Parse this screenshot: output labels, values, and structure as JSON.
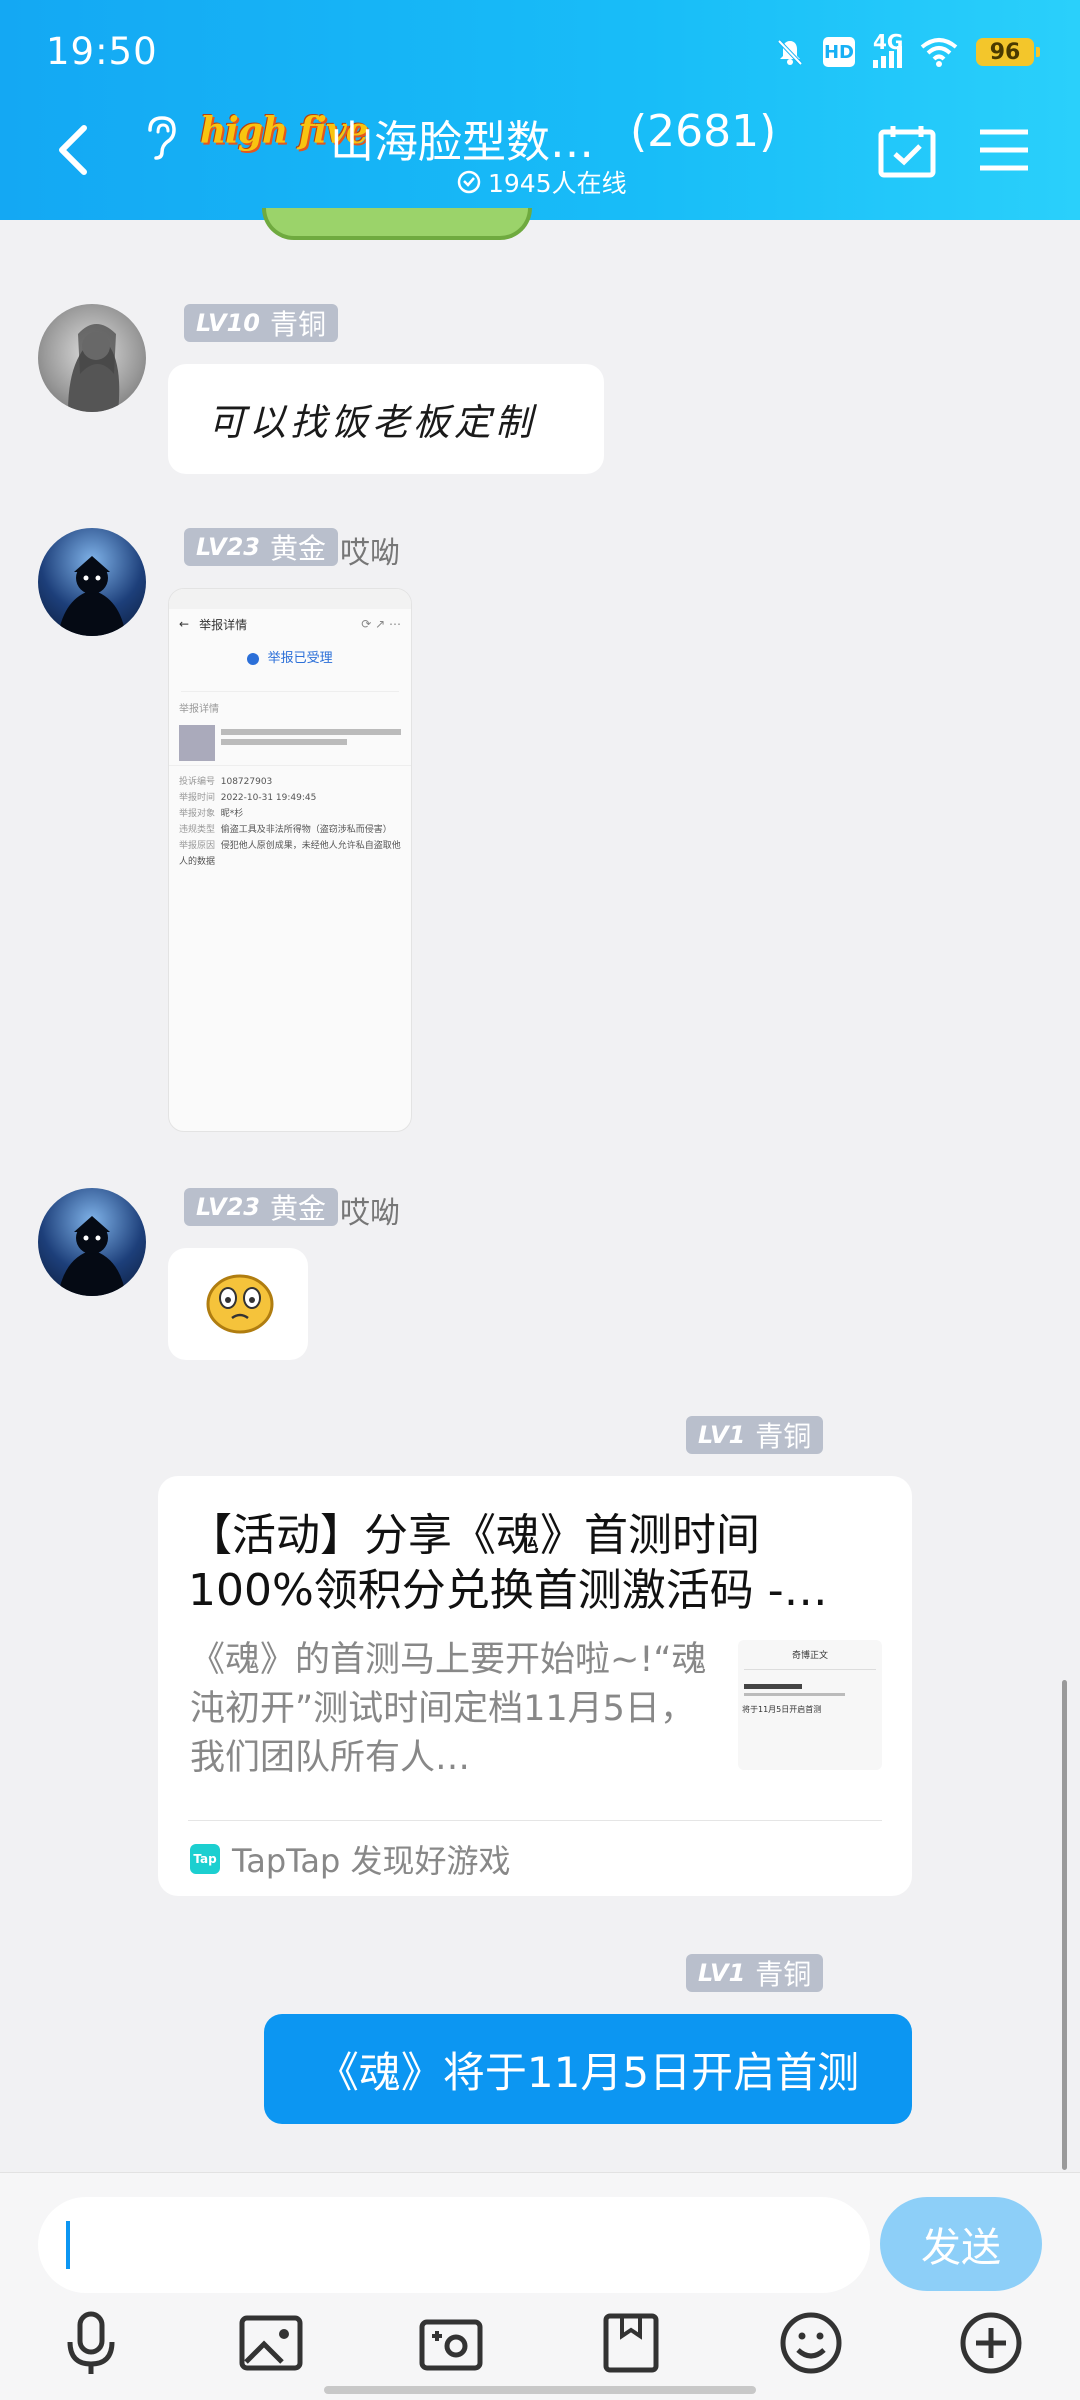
{
  "status_bar": {
    "time": "19:50",
    "network": "4G",
    "hd": "HD",
    "battery": "96"
  },
  "header": {
    "logo_text": "high five",
    "group_name": "山海脸型数…",
    "member_count": "(2681)",
    "online": "1945人在线"
  },
  "messages": [
    {
      "level": "LV10",
      "rank": "青铜",
      "name": "",
      "text": "可以找饭老板定制"
    },
    {
      "level": "LV23",
      "rank": "黄金",
      "name": "哎呦",
      "type": "image"
    },
    {
      "level": "LV23",
      "rank": "黄金",
      "name": "哎呦",
      "type": "sticker"
    },
    {
      "level": "LV1",
      "rank": "青铜",
      "type": "link",
      "card": {
        "title": "【活动】分享《魂》首测时间100%领积分兑换首测激活码 -…",
        "desc": "《魂》的首测马上要开始啦~!“魂沌初开”测试时间定档11月5日，我们团队所有人…",
        "source": "TapTap 发现好游戏",
        "source_logo": "Tap",
        "thumb_title": "奇博正文",
        "thumb_line": "将于11月5日开启首测"
      }
    },
    {
      "level": "LV1",
      "rank": "青铜",
      "type": "sent",
      "text": "《魂》将于11月5日开启首测"
    }
  ],
  "screenshot": {
    "header_title": "举报详情",
    "status": "举报已受理",
    "section": "举报详情",
    "rows": [
      {
        "label": "投诉编号",
        "value": "108727903"
      },
      {
        "label": "举报时间",
        "value": "2022-10-31 19:49:45"
      },
      {
        "label": "举报对象",
        "value": "昵*杉"
      },
      {
        "label": "违规类型",
        "value": "偷盗工具及非法所得物（盗窃涉私而侵害）"
      },
      {
        "label": "举报原因",
        "value": "侵犯他人原创成果，未经他人允许私自盗取他人的数据"
      }
    ]
  },
  "input": {
    "placeholder": "",
    "send_label": "发送"
  },
  "toolbar": [
    "mic-icon",
    "image-icon",
    "camera-icon",
    "file-icon",
    "emoji-icon",
    "plus-icon"
  ]
}
